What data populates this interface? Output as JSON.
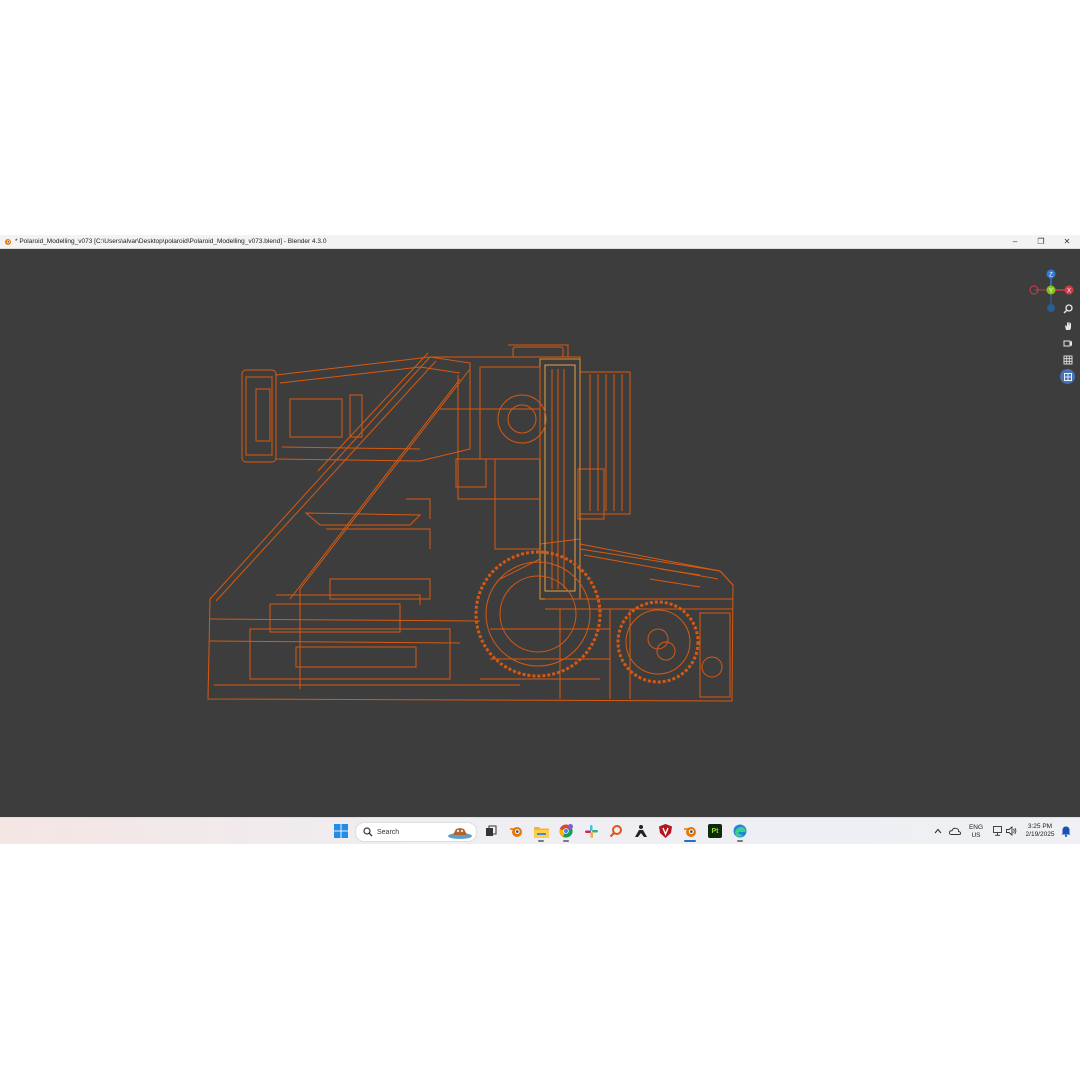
{
  "window": {
    "title": "* Polaroid_Modelling_v073 [C:\\Users\\alvar\\Desktop\\polaroid\\Polaroid_Modelling_v073.blend] - Blender 4.3.0",
    "controls": {
      "minimize": "–",
      "maximize": "❐",
      "close": "✕"
    }
  },
  "viewport": {
    "gizmo": {
      "z": "Z",
      "y": "Y",
      "x": "X"
    },
    "nav_icons": [
      "zoom-icon",
      "pan-hand-icon",
      "camera-view-icon",
      "grid-view-icon",
      "toggle-view-icon"
    ],
    "wire_color": "#e85d0c",
    "background_color": "#3d3d3d"
  },
  "taskbar": {
    "search_placeholder": "Search",
    "pinned": [
      "windows-start-icon",
      "search-icon",
      "task-view-icon",
      "blender-icon",
      "file-explorer-icon",
      "chrome-icon",
      "slack-icon",
      "search-app-icon",
      "zbrush-icon",
      "app-shield-icon",
      "blender-active-icon",
      "photoshop-pt-icon",
      "edge-icon"
    ],
    "pt_label": "Pt",
    "tray": {
      "lang_line1": "ENG",
      "lang_line2": "US",
      "time": "3:25 PM",
      "date": "2/19/2025"
    }
  }
}
